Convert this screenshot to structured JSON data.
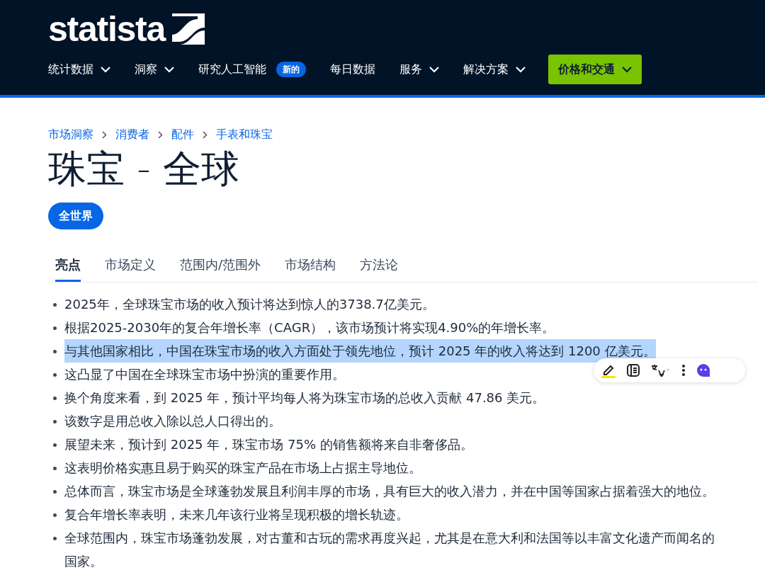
{
  "header": {
    "logo": "statista",
    "nav": [
      {
        "label": "统计数据",
        "kind": "menu",
        "caret": true
      },
      {
        "label": "洞察",
        "kind": "menu",
        "caret": true
      },
      {
        "label": "研究人工智能",
        "kind": "menu",
        "caret": false,
        "badge": "新的"
      },
      {
        "label": "每日数据",
        "kind": "menu",
        "caret": false
      },
      {
        "label": "服务",
        "kind": "menu",
        "caret": true
      },
      {
        "label": "解决方案",
        "kind": "menu",
        "caret": true
      },
      {
        "label": "价格和交通",
        "kind": "cta",
        "caret": true
      }
    ]
  },
  "breadcrumb": [
    "市场洞察",
    "消费者",
    "配件",
    "手表和珠宝"
  ],
  "title": "珠宝 - 全球",
  "region_pill": "全世界",
  "tabs": [
    {
      "label": "亮点",
      "selected": true
    },
    {
      "label": "市场定义",
      "selected": false
    },
    {
      "label": "范围内/范围外",
      "selected": false
    },
    {
      "label": "市场结构",
      "selected": false
    },
    {
      "label": "方法论",
      "selected": false
    }
  ],
  "highlights": [
    {
      "text": "2025年，全球珠宝市场的收入预计将达到惊人的3738.7亿美元。",
      "selected": false
    },
    {
      "text": "根据2025-2030年的复合年增长率（CAGR），该市场预计将实现4.90%的年增长率。",
      "selected": false
    },
    {
      "text": "与其他国家相比，中国在珠宝市场的收入方面处于领先地位，预计 2025 年的收入将达到 1200 亿美元。",
      "selected": true
    },
    {
      "text": "这凸显了中国在全球珠宝市场中扮演的重要作用。",
      "selected": false
    },
    {
      "text": "换个角度来看，到 2025 年，预计平均每人将为珠宝市场的总收入贡献 47.86 美元。",
      "selected": false
    },
    {
      "text": "该数字是用总收入除以总人口得出的。",
      "selected": false
    },
    {
      "text": "展望未来，预计到 2025 年，珠宝市场 75% 的销售额将来自非奢侈品。",
      "selected": false
    },
    {
      "text": "这表明价格实惠且易于购买的珠宝产品在市场上占据主导地位。",
      "selected": false
    },
    {
      "text": "总体而言，珠宝市场是全球蓬勃发展且利润丰厚的市场，具有巨大的收入潜力，并在中国等国家占据着强大的地位。",
      "selected": false
    },
    {
      "text": "复合年增长率表明，未来几年该行业将呈现积极的增长轨迹。",
      "selected": false
    },
    {
      "text": "全球范围内，珠宝市场蓬勃发展，对古董和古玩的需求再度兴起，尤其是在意大利和法国等以丰富文化遗产而闻名的国家。",
      "selected": false
    }
  ]
}
